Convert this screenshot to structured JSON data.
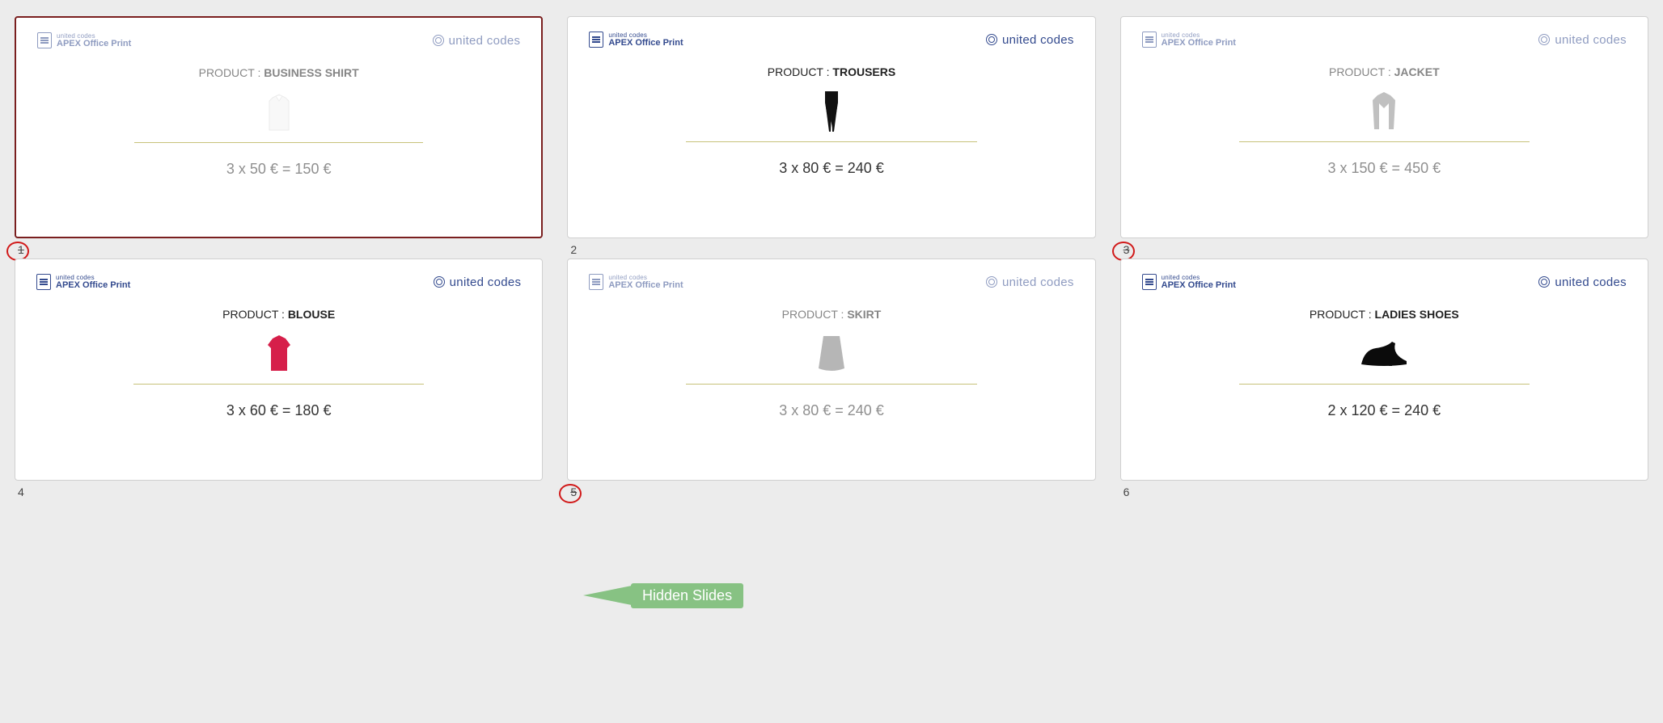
{
  "brand": {
    "line1": "united codes",
    "line2": "APEX Office Print",
    "right": "united codes"
  },
  "product_label_prefix": "PRODUCT : ",
  "annotation": "Hidden Slides",
  "slides": [
    {
      "num": "1",
      "product": "BUSINESS SHIRT",
      "calc": "3 x 50 € = 150 €",
      "selected": true,
      "hidden": true,
      "icon": "shirt"
    },
    {
      "num": "2",
      "product": "TROUSERS",
      "calc": "3 x 80 € = 240 €",
      "selected": false,
      "hidden": false,
      "icon": "trousers"
    },
    {
      "num": "3",
      "product": "JACKET",
      "calc": "3 x 150 € = 450 €",
      "selected": false,
      "hidden": true,
      "icon": "jacket"
    },
    {
      "num": "4",
      "product": "BLOUSE",
      "calc": "3 x 60 € = 180 €",
      "selected": false,
      "hidden": false,
      "icon": "blouse"
    },
    {
      "num": "5",
      "product": "SKIRT",
      "calc": "3 x 80 € = 240 €",
      "selected": false,
      "hidden": true,
      "icon": "skirt"
    },
    {
      "num": "6",
      "product": "LADIES SHOES",
      "calc": "2 x 120 € = 240 €",
      "selected": false,
      "hidden": false,
      "icon": "shoe"
    }
  ]
}
